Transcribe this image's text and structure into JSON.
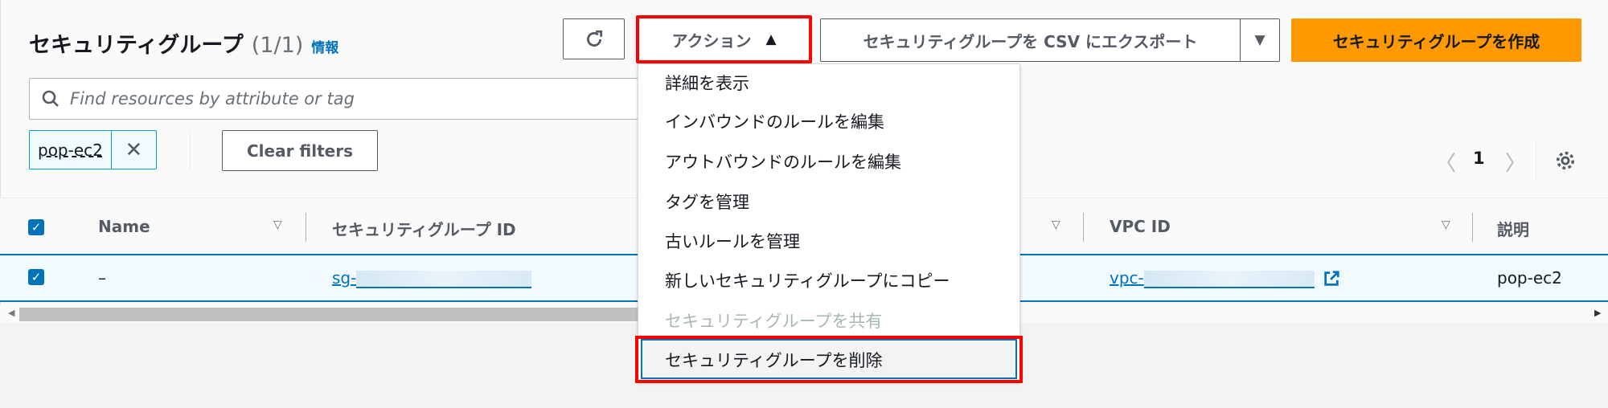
{
  "header": {
    "title": "セキュリティグループ",
    "count": "(1/1)",
    "info_link": "情報"
  },
  "toolbar": {
    "refresh_icon": "refresh-icon",
    "actions_label": "アクション",
    "actions_caret": "▲",
    "export_label": "セキュリティグループを CSV にエクスポート",
    "export_caret": "▼",
    "create_label": "セキュリティグループを作成"
  },
  "colors": {
    "primary": "#ff9900",
    "link": "#0073bb",
    "highlight": "#ff0000"
  },
  "search": {
    "placeholder": "Find resources by attribute or tag",
    "value": ""
  },
  "filters": {
    "token": "pop-ec2",
    "remove": "✕",
    "clear_label": "Clear filters"
  },
  "pagination": {
    "prev": "〈",
    "page": "1",
    "next": "〉"
  },
  "table": {
    "columns": [
      "Name",
      "セキュリティグループ ID",
      "VPC ID",
      "説明"
    ],
    "rows": [
      {
        "selected": true,
        "name": "–",
        "sg_id": "sg-",
        "vpc_id": "vpc-",
        "description": "pop-ec2"
      }
    ]
  },
  "menu": {
    "items": [
      {
        "label": "詳細を表示",
        "disabled": false
      },
      {
        "label": "インバウンドのルールを編集",
        "disabled": false
      },
      {
        "label": "アウトバウンドのルールを編集",
        "disabled": false
      },
      {
        "label": "タグを管理",
        "disabled": false
      },
      {
        "label": "古いルールを管理",
        "disabled": false
      },
      {
        "label": "新しいセキュリティグループにコピー",
        "disabled": false
      },
      {
        "label": "セキュリティグループを共有",
        "disabled": true
      },
      {
        "label": "セキュリティグループを削除",
        "disabled": false
      }
    ]
  }
}
